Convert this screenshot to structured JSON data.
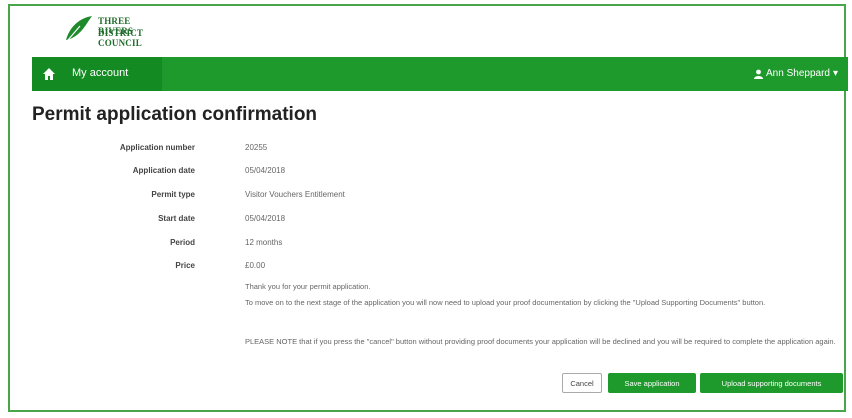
{
  "logo": {
    "line1": "THREE RIVERS",
    "line2": "DISTRICT COUNCIL"
  },
  "nav": {
    "home_icon": "home-icon",
    "link": "My account",
    "user": "Ann Sheppard"
  },
  "page": {
    "title": "Permit application confirmation"
  },
  "details": [
    {
      "label": "Application number",
      "value": "20255"
    },
    {
      "label": "Application date",
      "value": "05/04/2018"
    },
    {
      "label": "Permit type",
      "value": "Visitor Vouchers Entitlement"
    },
    {
      "label": "Start date",
      "value": "05/04/2018"
    },
    {
      "label": "Period",
      "value": "12 months"
    },
    {
      "label": "Price",
      "value": "£0.00"
    }
  ],
  "messages": {
    "thanks": "Thank you for your permit application.",
    "next_step": "To move on to the next stage of the application you will now need to upload your proof documentation by clicking the \"Upload Supporting Documents\" button.",
    "note": "PLEASE NOTE that if you press the \"cancel\" button without providing proof documents your application will be declined and you will be required to complete the application again."
  },
  "buttons": {
    "cancel": "Cancel",
    "save": "Save application",
    "upload": "Upload supporting documents"
  },
  "colors": {
    "brand_green": "#1e9a2c",
    "nav_dark": "#138a22",
    "frame": "#4aa54a"
  }
}
